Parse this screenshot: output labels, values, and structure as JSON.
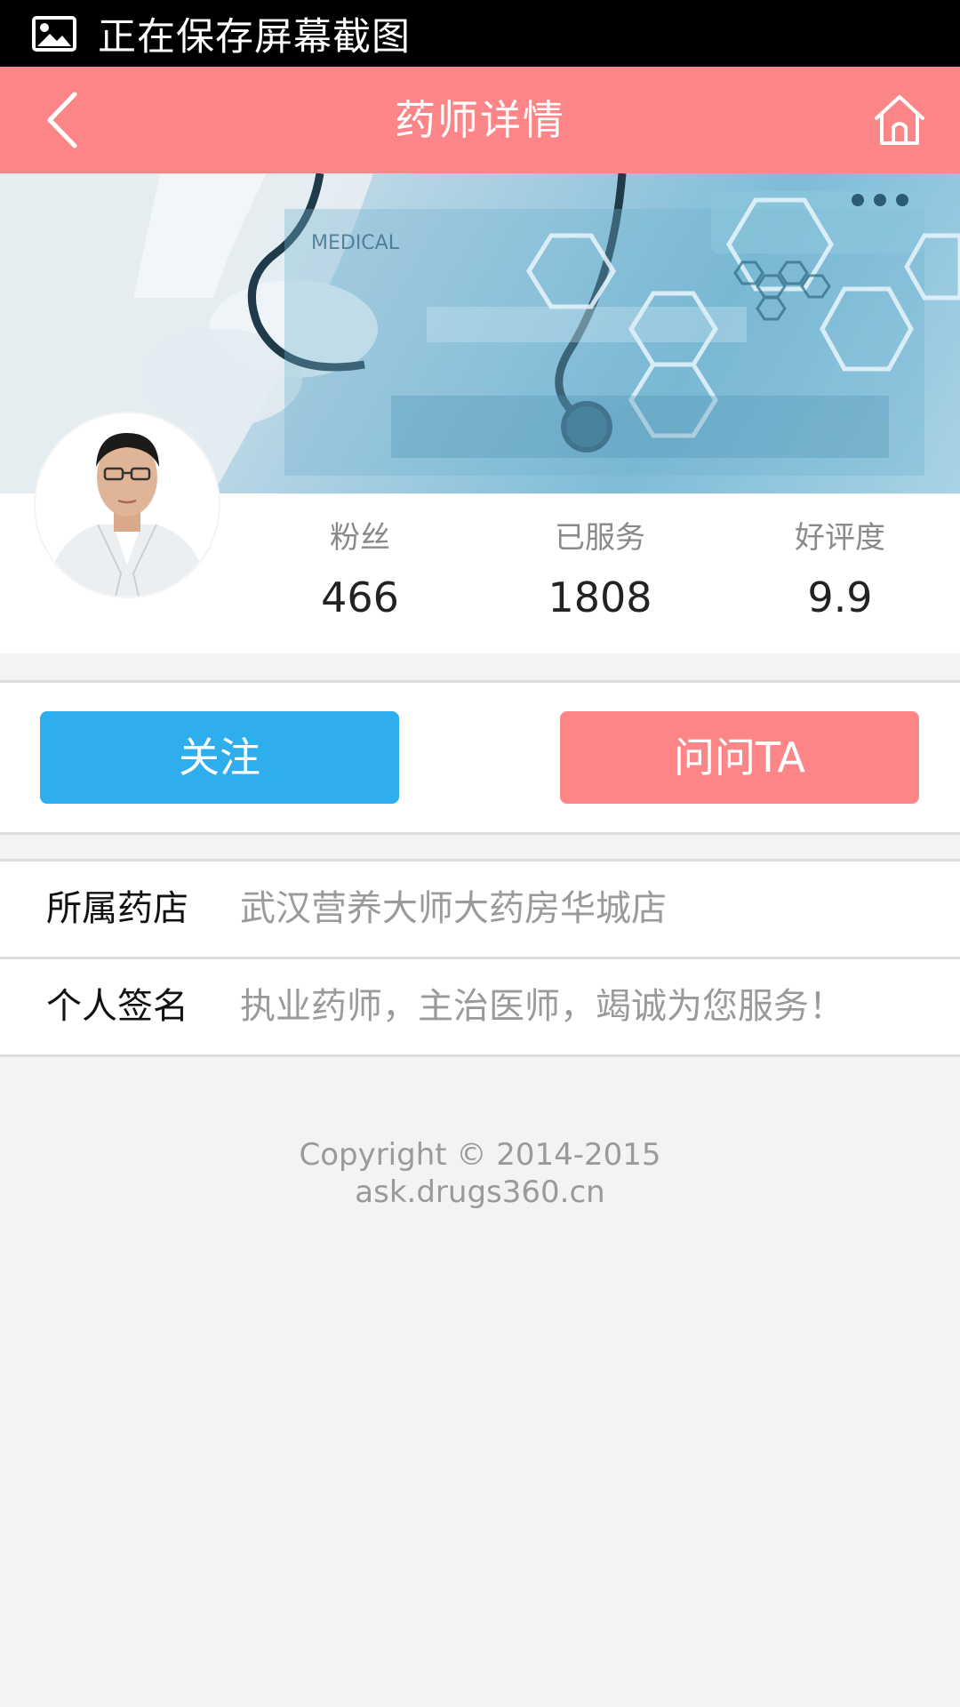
{
  "status_bar": {
    "icon": "image-icon",
    "text": "正在保存屏幕截图"
  },
  "header": {
    "title": "药师详情",
    "back_icon": "chevron-left-icon",
    "home_icon": "home-icon",
    "background_color": "#fb8587"
  },
  "banner": {
    "overlay_text": "MEDICAL"
  },
  "profile": {
    "stats": [
      {
        "label": "粉丝",
        "value": "466"
      },
      {
        "label": "已服务",
        "value": "1808"
      },
      {
        "label": "好评度",
        "value": "9.9"
      }
    ]
  },
  "actions": {
    "follow_label": "关注",
    "follow_color": "#2eaeed",
    "ask_label": "问问TA",
    "ask_color": "#fb8587"
  },
  "info": {
    "rows": [
      {
        "label": "所属药店",
        "value": "武汉营养大师大药房华城店"
      },
      {
        "label": "个人签名",
        "value": "执业药师，主治医师，竭诚为您服务！"
      }
    ]
  },
  "footer": {
    "copyright": "Copyright © 2014-2015",
    "domain": "ask.drugs360.cn"
  }
}
